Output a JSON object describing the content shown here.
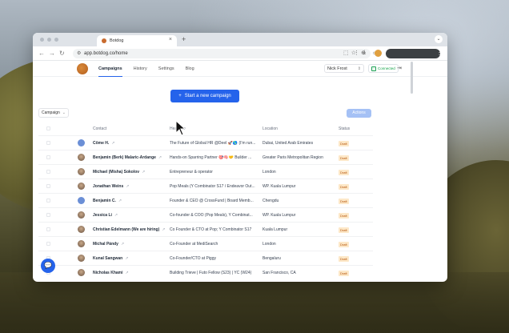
{
  "browser": {
    "tab_title": "Botdog",
    "tab_close": "×",
    "new_tab": "+",
    "url": "app.botdog.co/home",
    "colors": {
      "accent": "#2563eb"
    }
  },
  "nav": {
    "items": [
      {
        "label": "Campaigns",
        "active": true
      },
      {
        "label": "History"
      },
      {
        "label": "Settings"
      },
      {
        "label": "Blog"
      }
    ],
    "user": "Nick Frost",
    "connection_status": "Connected"
  },
  "cta": {
    "icon": "+",
    "label": "Start a new campaign"
  },
  "filter": {
    "label": "Campaign"
  },
  "actions_label": "Actions",
  "table": {
    "headers": {
      "contact": "Contact",
      "headline": "Headline",
      "location": "Location",
      "status": "Status"
    },
    "rows": [
      {
        "contact": "Côme H.",
        "headline": "The Future of Global HR @Deel 🚀🌎 (I'm run...",
        "location": "Dubai, United Arab Emirates",
        "status": "Draft",
        "avatar": "placeholder"
      },
      {
        "contact": "Benjamin (Berk) Malaric-Ardange",
        "headline": "Hands-on Sparring Partner 🎯🧠🤝 Builder ...",
        "location": "Greater Paris Metropolitan Region",
        "status": "Draft",
        "avatar": "photo"
      },
      {
        "contact": "Michael (Misha) Sokolov",
        "headline": "Entrepreneur & operator",
        "location": "London",
        "status": "Draft",
        "avatar": "photo"
      },
      {
        "contact": "Jonathan Weins",
        "headline": "Pop Meals (Y Combinator S17 / Endeavor Out...",
        "location": "WP. Kuala Lumpur",
        "status": "Draft",
        "avatar": "photo"
      },
      {
        "contact": "Benjamin C.",
        "headline": "Founder & CEO @ CrossFund | Board Memb...",
        "location": "Chengdu",
        "status": "Draft",
        "avatar": "placeholder"
      },
      {
        "contact": "Jessica Li",
        "headline": "Co-founder & COO (Pop Meals), Y Combinat...",
        "location": "WP. Kuala Lumpur",
        "status": "Draft",
        "avatar": "photo"
      },
      {
        "contact": "Christian Edelmann (We are hiring)",
        "headline": "Co Founder & CTO at Pop; Y Combinator S17",
        "location": "Kuala Lumpur",
        "status": "Draft",
        "avatar": "photo"
      },
      {
        "contact": "Michal Pándy",
        "headline": "Co-Founder at MediSearch",
        "location": "London",
        "status": "Draft",
        "avatar": "photo"
      },
      {
        "contact": "Kunal Sangwan",
        "headline": "Co-Founder/CTO at Piggy",
        "location": "Bengaluru",
        "status": "Draft",
        "avatar": "photo"
      },
      {
        "contact": "Nicholas Khami",
        "headline": "Building Trieve | Futo Fellow (S23) | YC (W24)",
        "location": "San Francisco, CA",
        "status": "Draft",
        "avatar": "photo"
      }
    ]
  }
}
